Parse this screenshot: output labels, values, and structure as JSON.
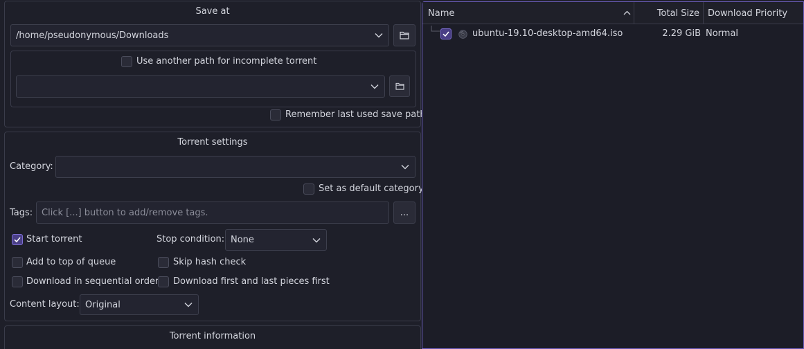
{
  "save_at": {
    "title": "Save at",
    "path_value": "/home/pseudonymous/Downloads",
    "incomplete_label": "Use another path for incomplete torrent",
    "incomplete_checked": false,
    "incomplete_path_value": "",
    "remember_label": "Remember last used save path",
    "remember_checked": false
  },
  "torrent_settings": {
    "title": "Torrent settings",
    "category_label": "Category:",
    "category_value": "",
    "default_category_label": "Set as default category",
    "tags_label": "Tags:",
    "tags_placeholder": "Click [...] button to add/remove tags.",
    "tags_button": "...",
    "start_torrent_label": "Start torrent",
    "start_torrent_checked": true,
    "stop_condition_label": "Stop condition:",
    "stop_condition_value": "None",
    "add_top_label": "Add to top of queue",
    "skip_hash_label": "Skip hash check",
    "sequential_label": "Download in sequential order",
    "first_last_label": "Download first and last pieces first",
    "content_layout_label": "Content layout:",
    "content_layout_value": "Original"
  },
  "torrent_information": {
    "title": "Torrent information"
  },
  "file_tree": {
    "columns": [
      "Name",
      "Total Size",
      "Download Priority"
    ],
    "rows": [
      {
        "name": "ubuntu-19.10-desktop-amd64.iso",
        "size": "2.29 GiB",
        "priority": "Normal",
        "checked": true
      }
    ]
  },
  "colors": {
    "accent": "#7d6ed3",
    "background": "#1e1f29"
  }
}
